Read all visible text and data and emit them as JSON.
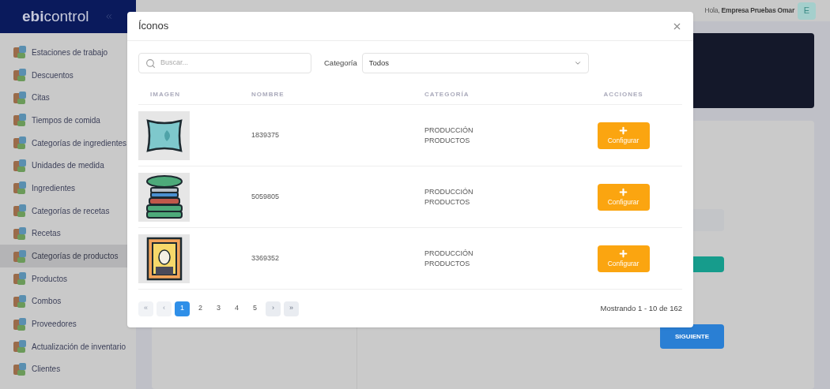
{
  "sidebar": {
    "logo": {
      "bold": "ebi",
      "light": "control"
    },
    "items": [
      {
        "label": "Estaciones de trabajo",
        "selected": false
      },
      {
        "label": "Descuentos",
        "selected": false
      },
      {
        "label": "Citas",
        "selected": false
      },
      {
        "label": "Tiempos de comida",
        "selected": false
      },
      {
        "label": "Categorías de ingredientes",
        "selected": false
      },
      {
        "label": "Unidades de medida",
        "selected": false
      },
      {
        "label": "Ingredientes",
        "selected": false
      },
      {
        "label": "Categorías de recetas",
        "selected": false
      },
      {
        "label": "Recetas",
        "selected": false
      },
      {
        "label": "Categorías de productos",
        "selected": true
      },
      {
        "label": "Productos",
        "selected": false
      },
      {
        "label": "Combos",
        "selected": false
      },
      {
        "label": "Proveedores",
        "selected": false
      },
      {
        "label": "Actualización de inventario",
        "selected": false
      },
      {
        "label": "Clientes",
        "selected": false
      }
    ]
  },
  "header": {
    "greeting": "Hola,",
    "user": "Empresa Pruebas Omar",
    "avatar": "E"
  },
  "background": {
    "next_button": "SIGUIENTE"
  },
  "modal": {
    "title": "Íconos",
    "search": {
      "placeholder": "Buscar..."
    },
    "category_filter": {
      "label": "Categoría",
      "value": "Todos"
    },
    "table": {
      "columns": [
        "IMAGEN",
        "NOMBRE",
        "CATEGORÍA",
        "ACCIONES"
      ],
      "rows": [
        {
          "kind": "pillow",
          "name": "1839375",
          "category": [
            "PRODUCCIÓN",
            "PRODUCTOS"
          ],
          "action": "Configurar"
        },
        {
          "kind": "towels",
          "name": "5059805",
          "category": [
            "PRODUCCIÓN",
            "PRODUCTOS"
          ],
          "action": "Configurar"
        },
        {
          "kind": "painting",
          "name": "3369352",
          "category": [
            "PRODUCCIÓN",
            "PRODUCTOS"
          ],
          "action": "Configurar"
        }
      ]
    },
    "pagination": {
      "pages": [
        {
          "label": "«",
          "kind": "first",
          "disabled": true,
          "selected": false
        },
        {
          "label": "‹",
          "kind": "prev",
          "disabled": true,
          "selected": false
        },
        {
          "label": "1",
          "kind": "page",
          "disabled": false,
          "selected": true
        },
        {
          "label": "2",
          "kind": "page",
          "disabled": false,
          "selected": false
        },
        {
          "label": "3",
          "kind": "page",
          "disabled": false,
          "selected": false
        },
        {
          "label": "4",
          "kind": "page",
          "disabled": false,
          "selected": false
        },
        {
          "label": "5",
          "kind": "page",
          "disabled": false,
          "selected": false
        },
        {
          "label": "›",
          "kind": "next",
          "disabled": false,
          "selected": false
        },
        {
          "label": "»",
          "kind": "last",
          "disabled": false,
          "selected": false
        }
      ],
      "summary": "Mostrando 1 - 10 de 162"
    }
  }
}
